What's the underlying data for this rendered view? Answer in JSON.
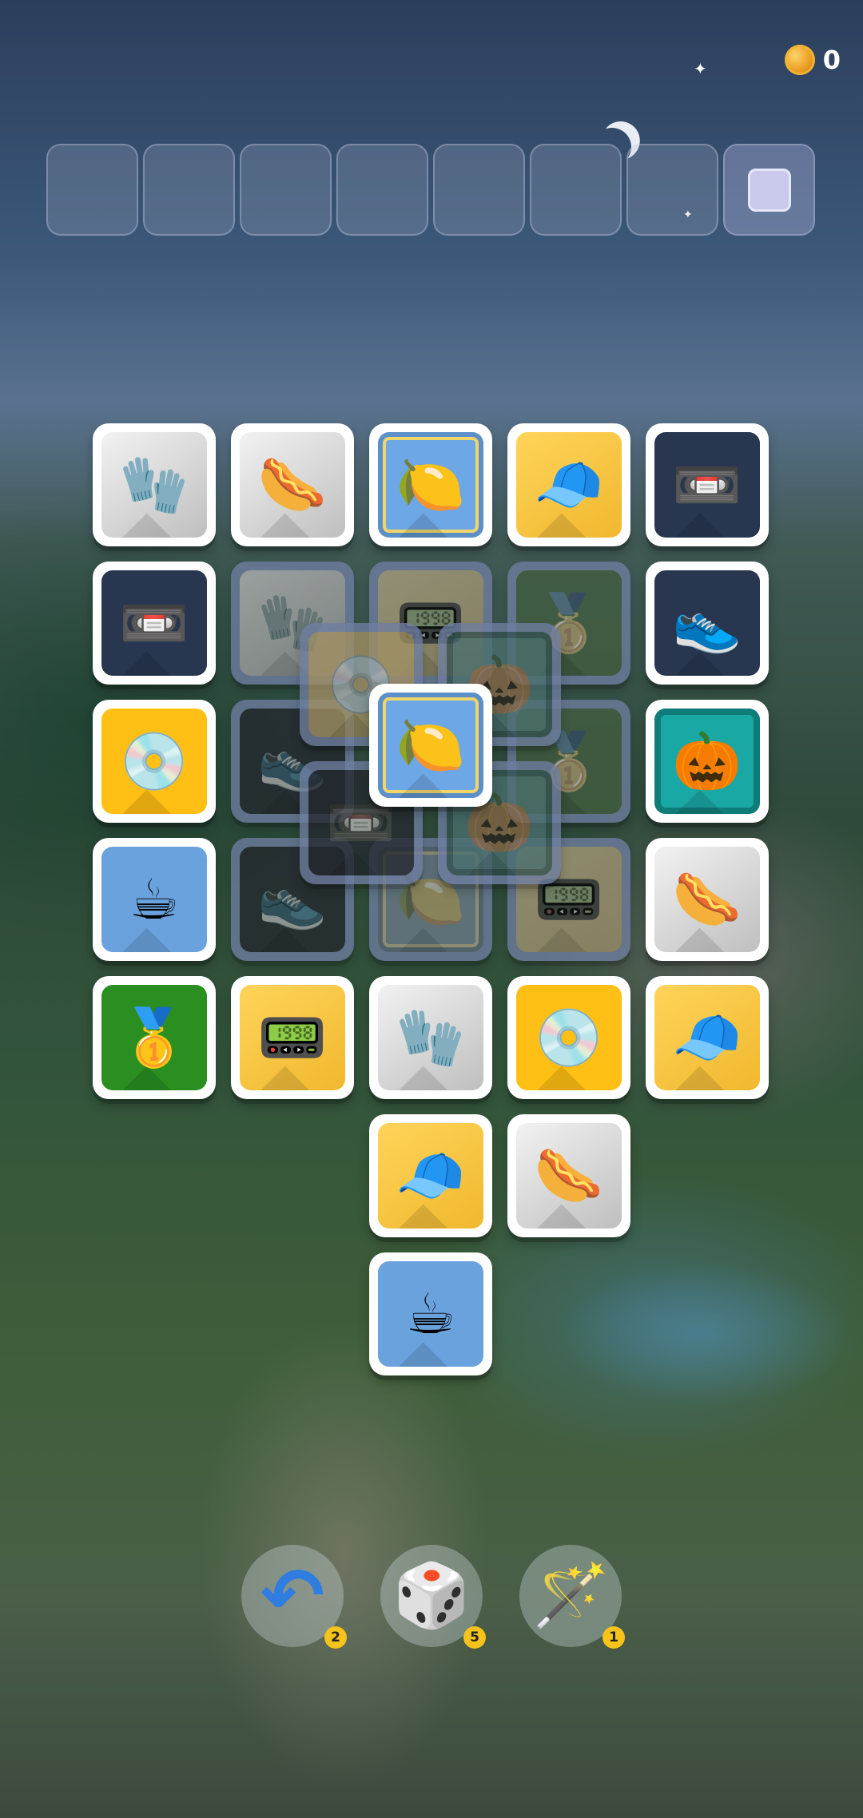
{
  "hud": {
    "coin_icon": "coin-icon",
    "coins": "0"
  },
  "tray": {
    "slot_count": 8
  },
  "tiles": [
    {
      "icon": "baseball-glove",
      "glyph": "🧤",
      "face": "gray",
      "active": true
    },
    {
      "icon": "hotdog",
      "glyph": "🌭",
      "face": "gray",
      "active": true
    },
    {
      "icon": "lemon",
      "glyph": "🍋",
      "face": "blue",
      "active": true
    },
    {
      "icon": "red-cap",
      "glyph": "🧢",
      "face": "yellow",
      "active": true
    },
    {
      "icon": "cassette",
      "glyph": "📼",
      "face": "navy",
      "active": true
    },
    {
      "icon": "cassette",
      "glyph": "📼",
      "face": "navy",
      "active": true
    },
    {
      "icon": "sneaker",
      "glyph": "👟",
      "face": "navy",
      "active": true
    },
    {
      "icon": "vinyl-record",
      "glyph": "💿",
      "face": "gold",
      "active": true
    },
    {
      "icon": "pumpkin",
      "glyph": "🎃",
      "face": "teal",
      "active": true
    },
    {
      "icon": "coffee-cup",
      "glyph": "☕",
      "face": "blue2",
      "active": true
    },
    {
      "icon": "hotdog",
      "glyph": "🌭",
      "face": "gray",
      "active": true
    },
    {
      "icon": "gold-medal",
      "glyph": "🥇",
      "face": "green",
      "active": true
    },
    {
      "icon": "scoreboard",
      "glyph": "📟",
      "face": "yellow",
      "active": true
    },
    {
      "icon": "baseball-glove",
      "glyph": "🧤",
      "face": "gray",
      "active": true
    },
    {
      "icon": "vinyl-record",
      "glyph": "💿",
      "face": "gold",
      "active": true
    },
    {
      "icon": "red-cap",
      "glyph": "🧢",
      "face": "yellow",
      "active": true
    },
    {
      "icon": "red-cap",
      "glyph": "🧢",
      "face": "yellow",
      "active": true
    },
    {
      "icon": "hotdog",
      "glyph": "🌭",
      "face": "gray",
      "active": true
    },
    {
      "icon": "coffee-cup",
      "glyph": "☕",
      "face": "blue2",
      "active": true
    },
    {
      "icon": "baseball-glove",
      "glyph": "🧤",
      "face": "gray",
      "active": false
    },
    {
      "icon": "scoreboard",
      "glyph": "📟",
      "face": "yellow",
      "active": false
    },
    {
      "icon": "gold-medal",
      "glyph": "🥇",
      "face": "green",
      "active": false
    },
    {
      "icon": "sneaker",
      "glyph": "👟",
      "face": "navy",
      "active": false
    },
    {
      "icon": "gold-medal",
      "glyph": "🥇",
      "face": "green",
      "active": false
    },
    {
      "icon": "sneaker",
      "glyph": "👟",
      "face": "navy",
      "active": false
    },
    {
      "icon": "lemon",
      "glyph": "🍋",
      "face": "blue",
      "active": false
    },
    {
      "icon": "scoreboard",
      "glyph": "📟",
      "face": "yellow",
      "active": false
    },
    {
      "icon": "vinyl-record",
      "glyph": "💿",
      "face": "gold",
      "active": false
    },
    {
      "icon": "pumpkin",
      "glyph": "🎃",
      "face": "teal",
      "active": false
    },
    {
      "icon": "cassette",
      "glyph": "📼",
      "face": "navy",
      "active": false
    },
    {
      "icon": "pumpkin",
      "glyph": "🎃",
      "face": "teal",
      "active": false
    },
    {
      "icon": "lemon",
      "glyph": "🍋",
      "face": "blue",
      "active": true
    }
  ],
  "boosters": [
    {
      "name": "undo",
      "icon": "undo-arrow-icon",
      "glyph": "↶",
      "count": "2"
    },
    {
      "name": "shuffle",
      "icon": "dice-icon",
      "glyph": "🎲",
      "count": "5"
    },
    {
      "name": "magic-wand",
      "icon": "magic-wand-icon",
      "glyph": "🪄",
      "count": "1"
    }
  ]
}
